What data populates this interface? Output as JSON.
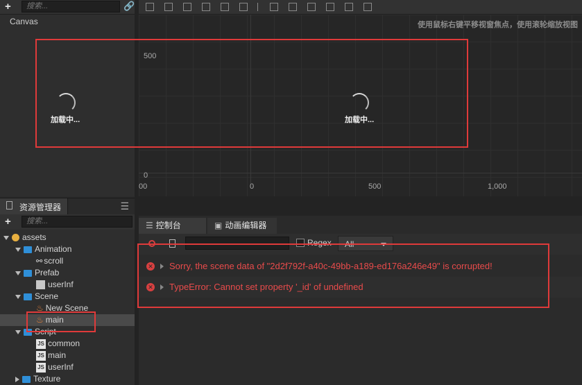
{
  "hierarchy": {
    "search_placeholder": "搜索...",
    "root": "Canvas"
  },
  "scene": {
    "hint": "使用鼠标右键平移视窗焦点，使用滚轮缩放视图",
    "y_ticks": [
      "500",
      "0"
    ],
    "x_ticks": [
      "00",
      "0",
      "500",
      "1,000"
    ],
    "loading_text": "加载中..."
  },
  "assets": {
    "panel_title": "资源管理器",
    "search_placeholder": "搜索...",
    "tree": {
      "root": "assets",
      "animation": "Animation",
      "scroll": "scroll",
      "prefab": "Prefab",
      "userInf_prefab": "userInf",
      "scene": "Scene",
      "new_scene": "New Scene",
      "main_scene": "main",
      "script": "Script",
      "common": "common",
      "main_script": "main",
      "userInf_script": "userInf",
      "texture": "Texture"
    },
    "js_badge": "JS"
  },
  "console": {
    "tabs": [
      "控制台",
      "动画编辑器"
    ],
    "regex_label": "Regex",
    "filter_value": "All",
    "logs": [
      "Sorry, the scene data of \"2d2f792f-a40c-49bb-a189-ed176a246e49\" is corrupted!",
      "TypeError: Cannot set property '_id' of undefined"
    ]
  },
  "colors": {
    "highlight": "#e03a3a",
    "error_text": "#e84b4b",
    "folder": "#2f8fd8"
  }
}
